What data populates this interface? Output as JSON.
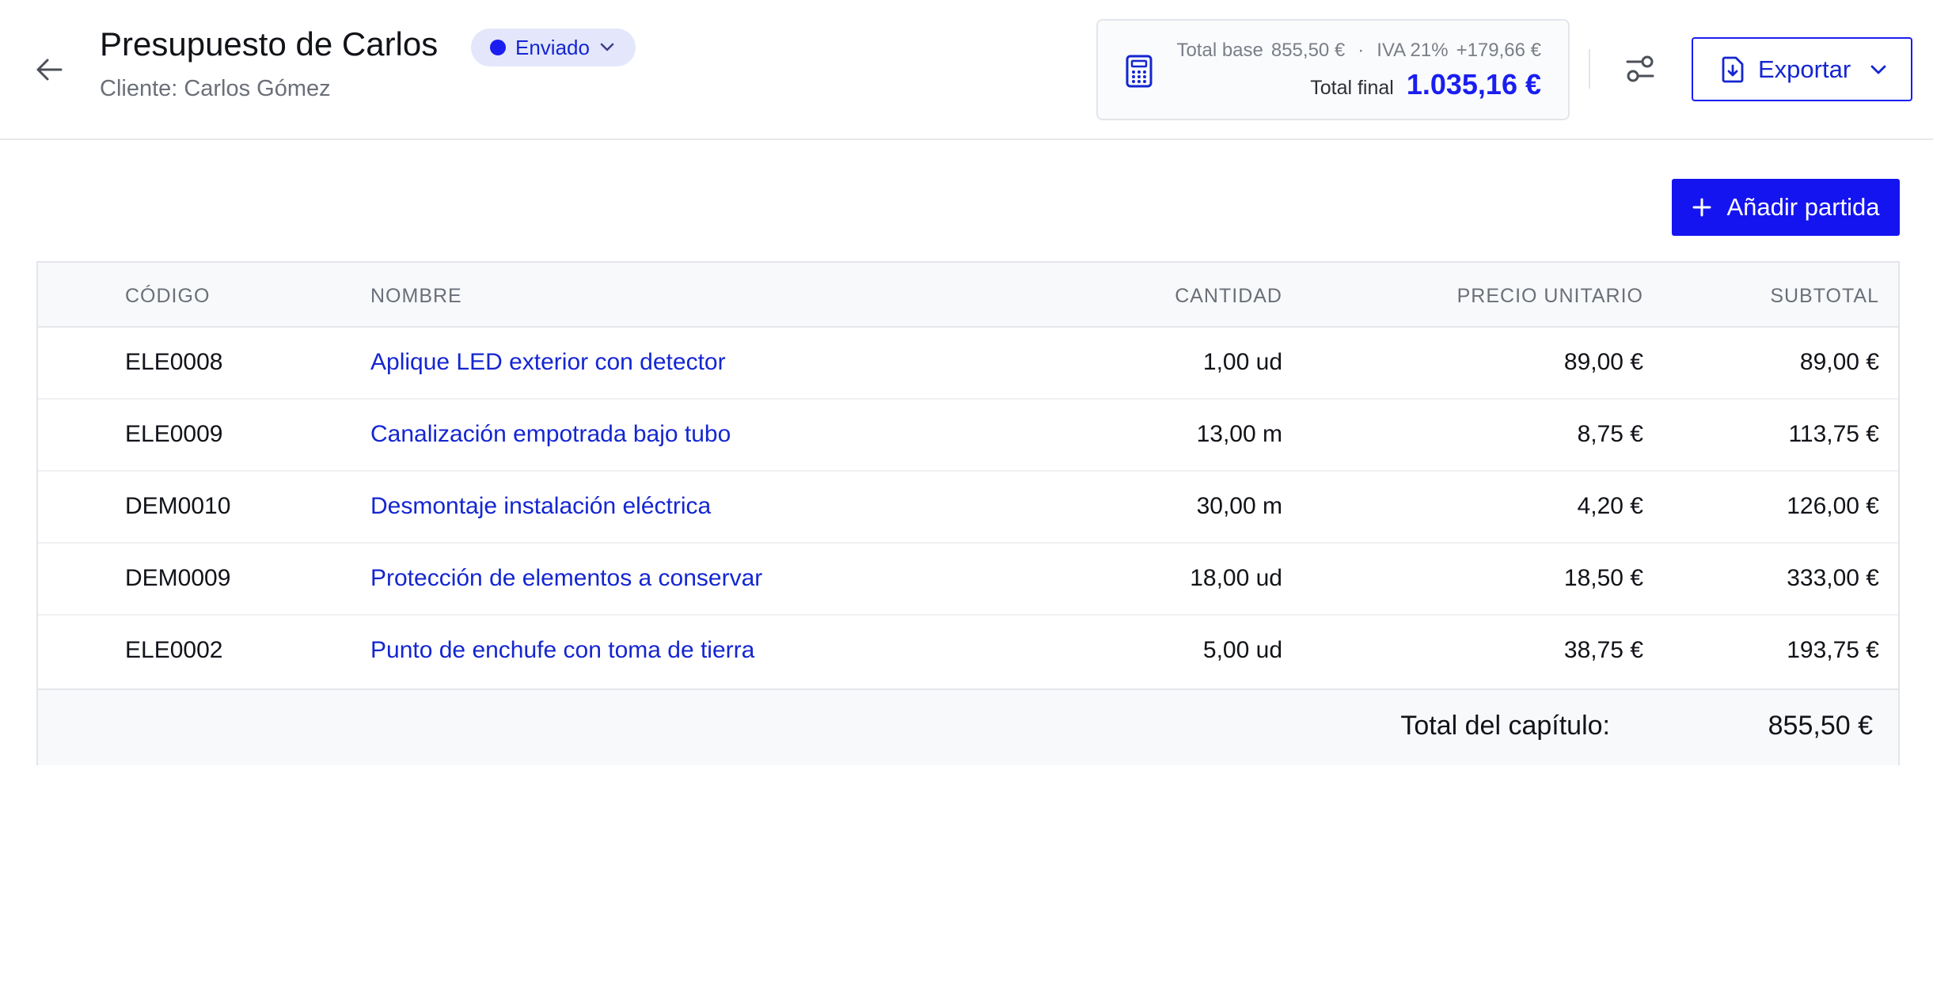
{
  "header": {
    "title": "Presupuesto de Carlos",
    "client_label": "Cliente:",
    "client_name": "Carlos Gómez",
    "status": "Enviado",
    "status_color": "#1a1ef0"
  },
  "totals": {
    "base_label": "Total base",
    "base_value": "855,50 €",
    "separator": "·",
    "iva_label": "IVA 21%",
    "iva_value": "+179,66 €",
    "final_label": "Total final",
    "final_value": "1.035,16 €",
    "icon": "calculator-icon"
  },
  "toolbar": {
    "settings_icon": "sliders-icon",
    "export_label": "Exportar",
    "export_icon": "file-download-icon"
  },
  "actions": {
    "add_label": "Añadir partida"
  },
  "table": {
    "columns": {
      "code": "CÓDIGO",
      "name": "NOMBRE",
      "qty": "CANTIDAD",
      "unit_price": "PRECIO UNITARIO",
      "subtotal": "SUBTOTAL"
    },
    "rows": [
      {
        "code": "ELE0008",
        "name": "Aplique LED exterior con detector",
        "qty": "1,00 ud",
        "unit_price": "89,00 €",
        "subtotal": "89,00 €"
      },
      {
        "code": "ELE0009",
        "name": "Canalización empotrada bajo tubo",
        "qty": "13,00 m",
        "unit_price": "8,75 €",
        "subtotal": "113,75 €"
      },
      {
        "code": "DEM0010",
        "name": "Desmontaje instalación eléctrica",
        "qty": "30,00 m",
        "unit_price": "4,20 €",
        "subtotal": "126,00 €"
      },
      {
        "code": "DEM0009",
        "name": "Protección de elementos a conservar",
        "qty": "18,00 ud",
        "unit_price": "18,50 €",
        "subtotal": "333,00 €"
      },
      {
        "code": "ELE0002",
        "name": "Punto de enchufe con toma de tierra",
        "qty": "5,00 ud",
        "unit_price": "38,75 €",
        "subtotal": "193,75 €"
      }
    ],
    "footer_label": "Total del capítulo:",
    "footer_value": "855,50 €"
  },
  "colors": {
    "accent": "#1a1ef0",
    "link": "#1426d0",
    "muted": "#6b6f78"
  }
}
